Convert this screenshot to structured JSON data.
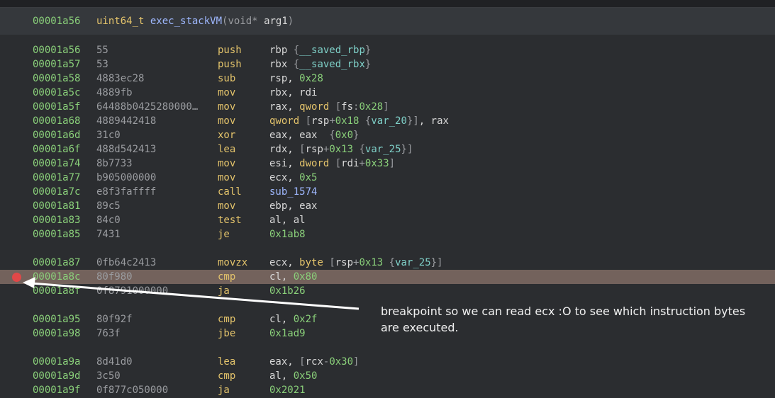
{
  "header": {
    "address": "00001a56",
    "return_type": "uint64_t",
    "function_name": "exec_stackVM",
    "param_type": "void*",
    "param_name": "arg1"
  },
  "lines": [
    {
      "addr": "00001a56",
      "bytes": "55",
      "mn": "push",
      "ops": [
        [
          "reg",
          "rbp "
        ],
        [
          "punc",
          "{"
        ],
        [
          "var",
          "__saved_rbp"
        ],
        [
          "punc",
          "}"
        ]
      ]
    },
    {
      "addr": "00001a57",
      "bytes": "53",
      "mn": "push",
      "ops": [
        [
          "reg",
          "rbx "
        ],
        [
          "punc",
          "{"
        ],
        [
          "var",
          "__saved_rbx"
        ],
        [
          "punc",
          "}"
        ]
      ]
    },
    {
      "addr": "00001a58",
      "bytes": "4883ec28",
      "mn": "sub",
      "ops": [
        [
          "reg",
          "rsp, "
        ],
        [
          "num",
          "0x28"
        ]
      ]
    },
    {
      "addr": "00001a5c",
      "bytes": "4889fb",
      "mn": "mov",
      "ops": [
        [
          "reg",
          "rbx, rdi"
        ]
      ]
    },
    {
      "addr": "00001a5f",
      "bytes": "64488b0425280000…",
      "mn": "mov",
      "ops": [
        [
          "reg",
          "rax, "
        ],
        [
          "size",
          "qword "
        ],
        [
          "punc",
          "["
        ],
        [
          "reg",
          "fs"
        ],
        [
          "punc",
          ":"
        ],
        [
          "num",
          "0x28"
        ],
        [
          "punc",
          "]"
        ]
      ]
    },
    {
      "addr": "00001a68",
      "bytes": "4889442418",
      "mn": "mov",
      "ops": [
        [
          "size",
          "qword "
        ],
        [
          "punc",
          "["
        ],
        [
          "reg",
          "rsp"
        ],
        [
          "punc",
          "+"
        ],
        [
          "num",
          "0x18"
        ],
        [
          "reg",
          " "
        ],
        [
          "punc",
          "{"
        ],
        [
          "var",
          "var_20"
        ],
        [
          "punc",
          "}"
        ],
        [
          "punc",
          "]"
        ],
        [
          "reg",
          ", rax"
        ]
      ]
    },
    {
      "addr": "00001a6d",
      "bytes": "31c0",
      "mn": "xor",
      "ops": [
        [
          "reg",
          "eax, eax  "
        ],
        [
          "punc",
          "{"
        ],
        [
          "num",
          "0x0"
        ],
        [
          "punc",
          "}"
        ]
      ]
    },
    {
      "addr": "00001a6f",
      "bytes": "488d542413",
      "mn": "lea",
      "ops": [
        [
          "reg",
          "rdx, "
        ],
        [
          "punc",
          "["
        ],
        [
          "reg",
          "rsp"
        ],
        [
          "punc",
          "+"
        ],
        [
          "num",
          "0x13"
        ],
        [
          "reg",
          " "
        ],
        [
          "punc",
          "{"
        ],
        [
          "var",
          "var_25"
        ],
        [
          "punc",
          "}"
        ],
        [
          "punc",
          "]"
        ]
      ]
    },
    {
      "addr": "00001a74",
      "bytes": "8b7733",
      "mn": "mov",
      "ops": [
        [
          "reg",
          "esi, "
        ],
        [
          "size",
          "dword "
        ],
        [
          "punc",
          "["
        ],
        [
          "reg",
          "rdi"
        ],
        [
          "punc",
          "+"
        ],
        [
          "num",
          "0x33"
        ],
        [
          "punc",
          "]"
        ]
      ]
    },
    {
      "addr": "00001a77",
      "bytes": "b905000000",
      "mn": "mov",
      "ops": [
        [
          "reg",
          "ecx, "
        ],
        [
          "num",
          "0x5"
        ]
      ]
    },
    {
      "addr": "00001a7c",
      "bytes": "e8f3faffff",
      "mn": "call",
      "ops": [
        [
          "sym",
          "sub_1574"
        ]
      ]
    },
    {
      "addr": "00001a81",
      "bytes": "89c5",
      "mn": "mov",
      "ops": [
        [
          "reg",
          "ebp, eax"
        ]
      ]
    },
    {
      "addr": "00001a83",
      "bytes": "84c0",
      "mn": "test",
      "ops": [
        [
          "reg",
          "al, al"
        ]
      ]
    },
    {
      "addr": "00001a85",
      "bytes": "7431",
      "mn": "je",
      "ops": [
        [
          "num",
          "0x1ab8"
        ]
      ]
    },
    {
      "addr": "00001a87",
      "bytes": "0fb64c2413",
      "mn": "movzx",
      "ops": [
        [
          "reg",
          "ecx, "
        ],
        [
          "size",
          "byte "
        ],
        [
          "punc",
          "["
        ],
        [
          "reg",
          "rsp"
        ],
        [
          "punc",
          "+"
        ],
        [
          "num",
          "0x13"
        ],
        [
          "reg",
          " "
        ],
        [
          "punc",
          "{"
        ],
        [
          "var",
          "var_25"
        ],
        [
          "punc",
          "}"
        ],
        [
          "punc",
          "]"
        ]
      ]
    },
    {
      "addr": "00001a8c",
      "bytes": "80f980",
      "mn": "cmp",
      "ops": [
        [
          "reg",
          "cl, "
        ],
        [
          "num",
          "0x80"
        ]
      ],
      "highlight": true,
      "breakpoint": true
    },
    {
      "addr": "00001a8f",
      "bytes": "0f8791000000",
      "mn": "ja",
      "ops": [
        [
          "num",
          "0x1b26"
        ]
      ]
    },
    {
      "addr": "00001a95",
      "bytes": "80f92f",
      "mn": "cmp",
      "ops": [
        [
          "reg",
          "cl, "
        ],
        [
          "num",
          "0x2f"
        ]
      ]
    },
    {
      "addr": "00001a98",
      "bytes": "763f",
      "mn": "jbe",
      "ops": [
        [
          "num",
          "0x1ad9"
        ]
      ]
    },
    {
      "addr": "00001a9a",
      "bytes": "8d41d0",
      "mn": "lea",
      "ops": [
        [
          "reg",
          "eax, "
        ],
        [
          "punc",
          "["
        ],
        [
          "reg",
          "rcx"
        ],
        [
          "punc",
          "-"
        ],
        [
          "num",
          "0x30"
        ],
        [
          "punc",
          "]"
        ]
      ]
    },
    {
      "addr": "00001a9d",
      "bytes": "3c50",
      "mn": "cmp",
      "ops": [
        [
          "reg",
          "al, "
        ],
        [
          "num",
          "0x50"
        ]
      ]
    },
    {
      "addr": "00001a9f",
      "bytes": "0f877c050000",
      "mn": "ja",
      "ops": [
        [
          "num",
          "0x2021"
        ]
      ]
    }
  ],
  "annotation": "breakpoint so we can read ecx :O to see which instruction bytes are executed."
}
